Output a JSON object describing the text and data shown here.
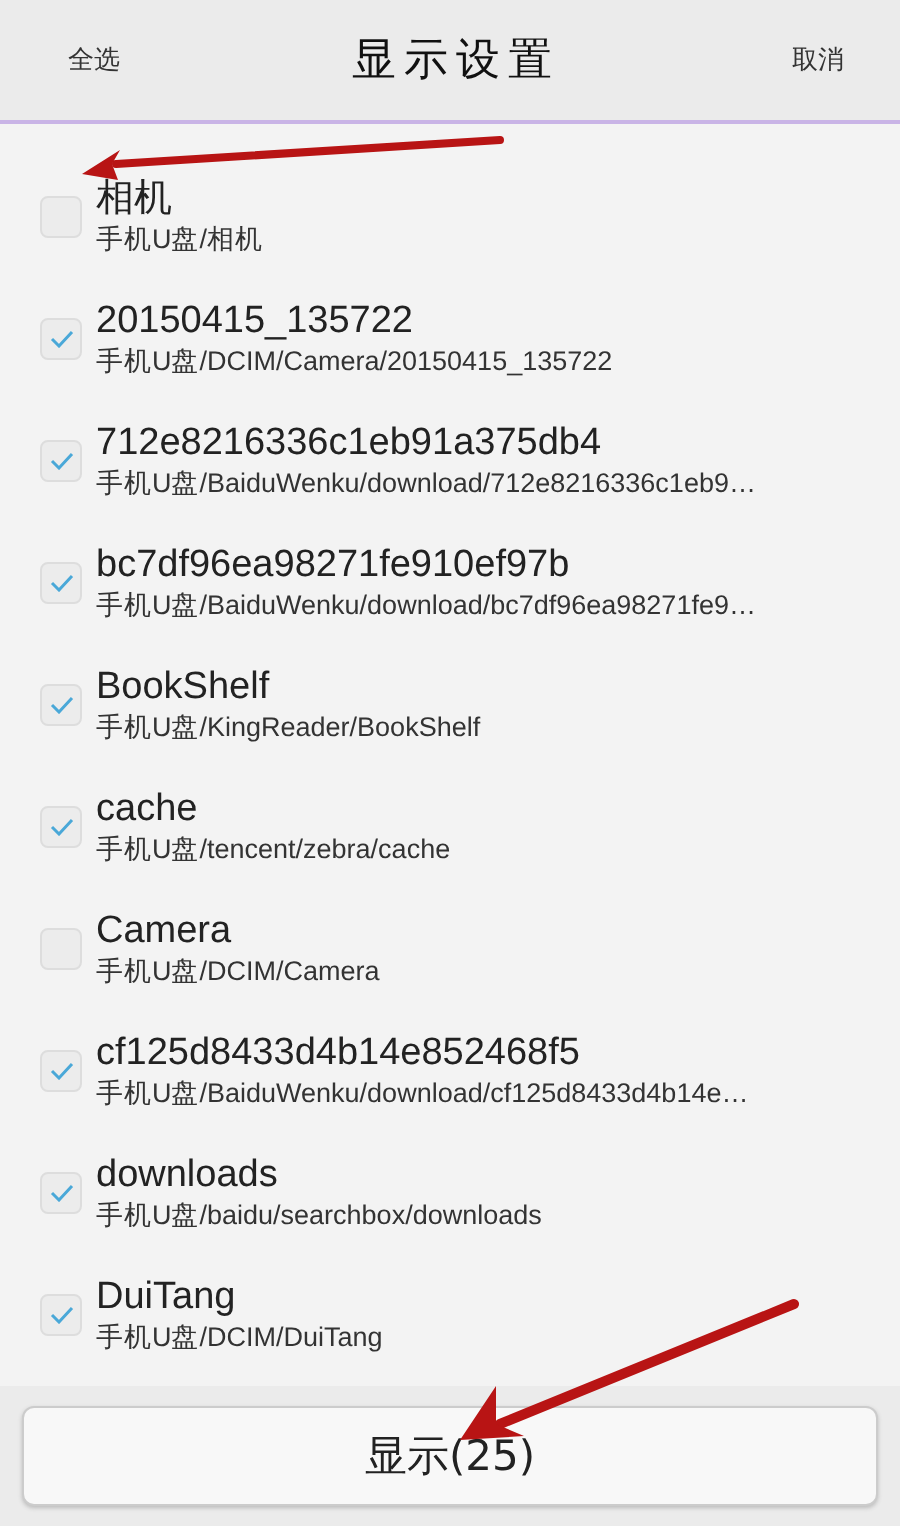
{
  "header": {
    "left_action": "全选",
    "title": "显示设置",
    "right_action": "取消"
  },
  "folders": [
    {
      "name": "相机",
      "path": "手机U盘/相机",
      "checked": false
    },
    {
      "name": "20150415_135722",
      "path": "手机U盘/DCIM/Camera/20150415_135722",
      "checked": true
    },
    {
      "name": "712e8216336c1eb91a375db4",
      "path": "手机U盘/BaiduWenku/download/712e8216336c1eb9…",
      "checked": true
    },
    {
      "name": "bc7df96ea98271fe910ef97b",
      "path": "手机U盘/BaiduWenku/download/bc7df96ea98271fe9…",
      "checked": true
    },
    {
      "name": "BookShelf",
      "path": "手机U盘/KingReader/BookShelf",
      "checked": true
    },
    {
      "name": "cache",
      "path": "手机U盘/tencent/zebra/cache",
      "checked": true
    },
    {
      "name": "Camera",
      "path": "手机U盘/DCIM/Camera",
      "checked": false
    },
    {
      "name": "cf125d8433d4b14e852468f5",
      "path": "手机U盘/BaiduWenku/download/cf125d8433d4b14e…",
      "checked": true
    },
    {
      "name": "downloads",
      "path": "手机U盘/baidu/searchbox/downloads",
      "checked": true
    },
    {
      "name": "DuiTang",
      "path": "手机U盘/DCIM/DuiTang",
      "checked": true
    }
  ],
  "show_button": "显示(25)"
}
